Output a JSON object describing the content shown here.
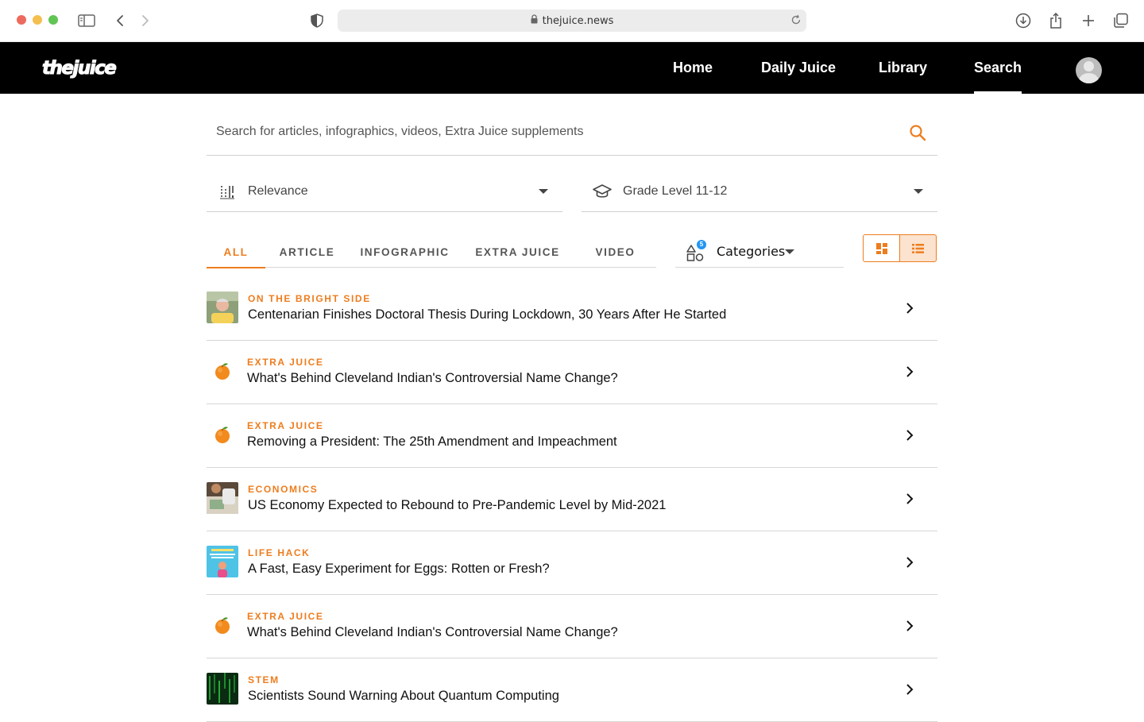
{
  "browser": {
    "url": "thejuice.news"
  },
  "nav": {
    "logo": "thejuice",
    "items": [
      {
        "label": "Home"
      },
      {
        "label": "Daily Juice"
      },
      {
        "label": "Library"
      },
      {
        "label": "Search"
      }
    ],
    "active": "Search"
  },
  "search": {
    "placeholder": "Search for articles, infographics, videos, Extra Juice supplements",
    "value": ""
  },
  "filters": {
    "sort": {
      "label": "Relevance",
      "icon": "sort-icon"
    },
    "grade": {
      "label": "Grade Level 11-12",
      "icon": "graduation-cap-icon"
    }
  },
  "tabs": [
    {
      "label": "ALL"
    },
    {
      "label": "ARTICLE"
    },
    {
      "label": "INFOGRAPHIC"
    },
    {
      "label": "EXTRA JUICE"
    },
    {
      "label": "VIDEO"
    }
  ],
  "categories": {
    "label": "Categories",
    "count": "5"
  },
  "view": {
    "selected": "list"
  },
  "colors": {
    "accent": "#ed7d1f",
    "nav_bg": "#000000",
    "badge": "#2196f3"
  },
  "results": [
    {
      "category": "ON THE BRIGHT SIDE",
      "title": "Centenarian Finishes Doctoral Thesis During Lockdown, 30 Years After He Started",
      "thumb": "photo-elderly-man"
    },
    {
      "category": "EXTRA JUICE",
      "title": "What's Behind Cleveland Indian's Controversial Name Change?",
      "thumb": "orange-icon"
    },
    {
      "category": "EXTRA JUICE",
      "title": "Removing a President: The 25th Amendment and Impeachment",
      "thumb": "orange-icon"
    },
    {
      "category": "ECONOMICS",
      "title": "US Economy Expected to Rebound to Pre-Pandemic Level by Mid-2021",
      "thumb": "photo-money"
    },
    {
      "category": "LIFE HACK",
      "title": "A Fast, Easy Experiment for Eggs: Rotten or Fresh?",
      "thumb": "photo-life-hack"
    },
    {
      "category": "EXTRA JUICE",
      "title": "What's Behind Cleveland Indian's Controversial Name Change?",
      "thumb": "orange-icon"
    },
    {
      "category": "STEM",
      "title": "Scientists Sound Warning About Quantum Computing",
      "thumb": "photo-quantum"
    }
  ]
}
